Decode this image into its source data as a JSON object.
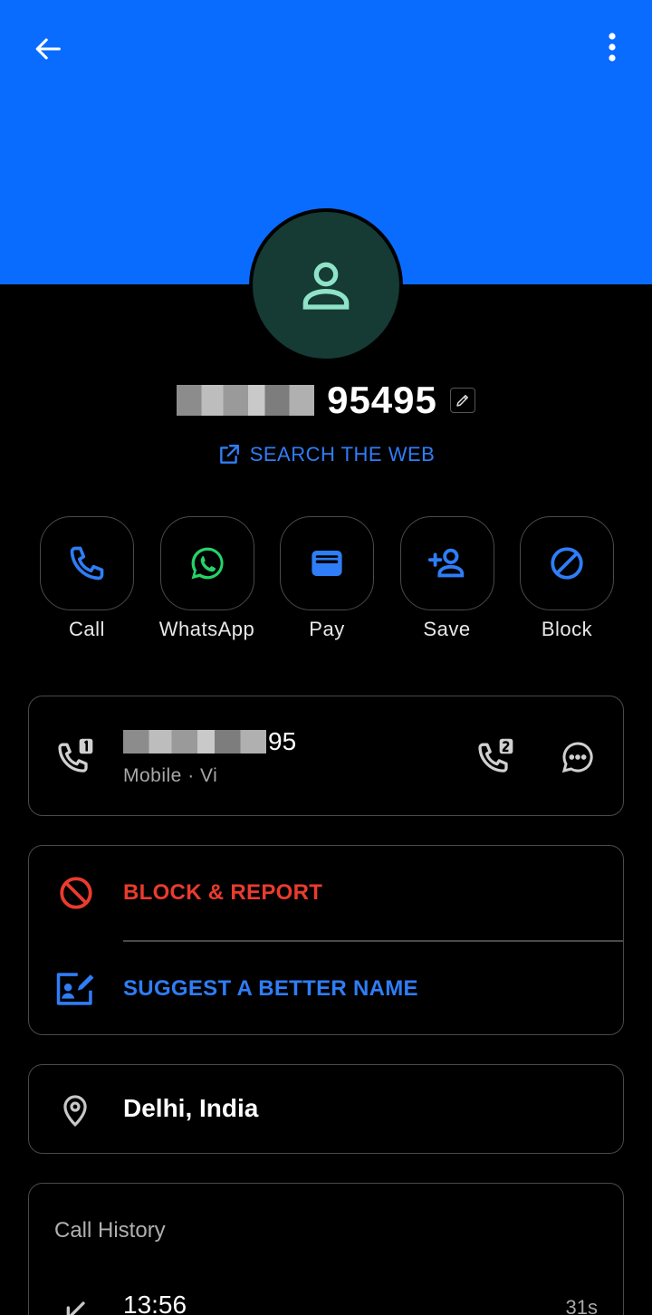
{
  "header": {
    "back_icon": "arrow-left-icon",
    "more_icon": "more-vertical-icon",
    "color": "#0a6cff"
  },
  "contact": {
    "avatar_icon": "person-icon",
    "name": "95495",
    "edit_icon": "edit-pencil-icon",
    "search_web_label": "SEARCH THE WEB"
  },
  "actions": [
    {
      "label": "Call",
      "icon": "phone-icon",
      "color": "#2f7df7"
    },
    {
      "label": "WhatsApp",
      "icon": "whatsapp-icon",
      "color": "#25d366"
    },
    {
      "label": "Pay",
      "icon": "wallet-icon",
      "color": "#2f7df7"
    },
    {
      "label": "Save",
      "icon": "add-person-icon",
      "color": "#2f7df7"
    },
    {
      "label": "Block",
      "icon": "block-icon",
      "color": "#2f7df7"
    }
  ],
  "phone": {
    "number_tail": "95",
    "type": "Mobile · Vi"
  },
  "options": {
    "block_report_label": "BLOCK & REPORT",
    "suggest_name_label": "SUGGEST A BETTER NAME"
  },
  "location": {
    "text": "Delhi, India"
  },
  "call_history": {
    "title": "Call History",
    "entries": [
      {
        "time": "13:56",
        "duration": "31s"
      }
    ]
  }
}
